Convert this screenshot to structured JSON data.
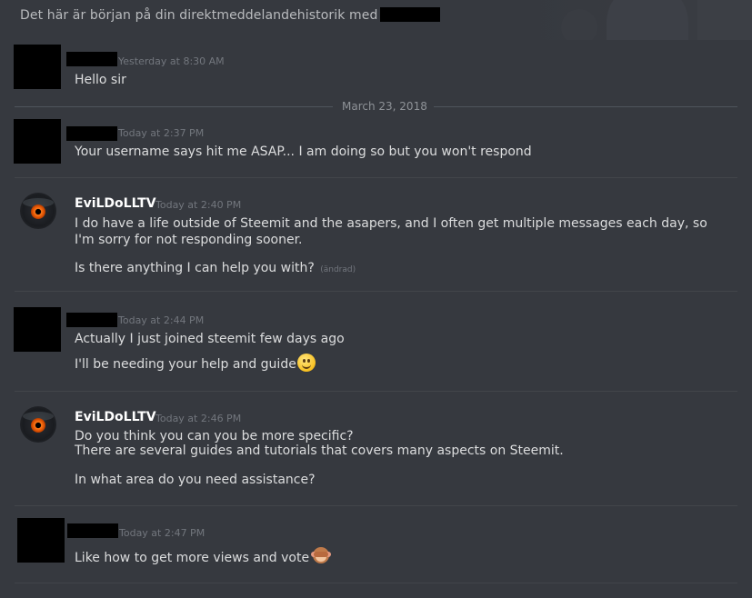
{
  "header": {
    "intro": "Det här är början på din direktmeddelandehistorik med"
  },
  "date_divider": "March 23, 2018",
  "messages": [
    {
      "author": "",
      "timestamp": "Yesterday at 8:30 AM",
      "lines": [
        "Hello sir"
      ]
    },
    {
      "author": "",
      "timestamp": "Today at 2:37 PM",
      "lines": [
        "Your username says hit me ASAP... I am doing so but you won't respond"
      ]
    },
    {
      "author": "EviLDoLLTV",
      "timestamp": "Today at 2:40 PM",
      "lines": [
        "I do have a life outside of Steemit and the asapers, and I often get multiple messages each day, so I'm sorry for not responding sooner.",
        "Is there anything I can help you with?"
      ],
      "edited": "(ändrad)"
    },
    {
      "author": "",
      "timestamp": "Today at 2:44 PM",
      "lines": [
        "Actually I just joined steemit few days ago",
        "I'll be needing your help and guide"
      ],
      "emoji": "slightly-smiling-face"
    },
    {
      "author": "EviLDoLLTV",
      "timestamp": "Today at 2:46 PM",
      "lines": [
        "Do you think you can you be more specific?",
        "There are several guides and tutorials that covers many aspects on Steemit.",
        "In what area do you need assistance?"
      ]
    },
    {
      "author": "",
      "timestamp": "Today at 2:47 PM",
      "lines": [
        "Like how to get more views and vote"
      ],
      "emoji": "see-no-evil-monkey"
    }
  ],
  "colors": {
    "background": "#36393f",
    "text": "#dcddde",
    "muted": "#72767d",
    "username": "#ffffff"
  }
}
